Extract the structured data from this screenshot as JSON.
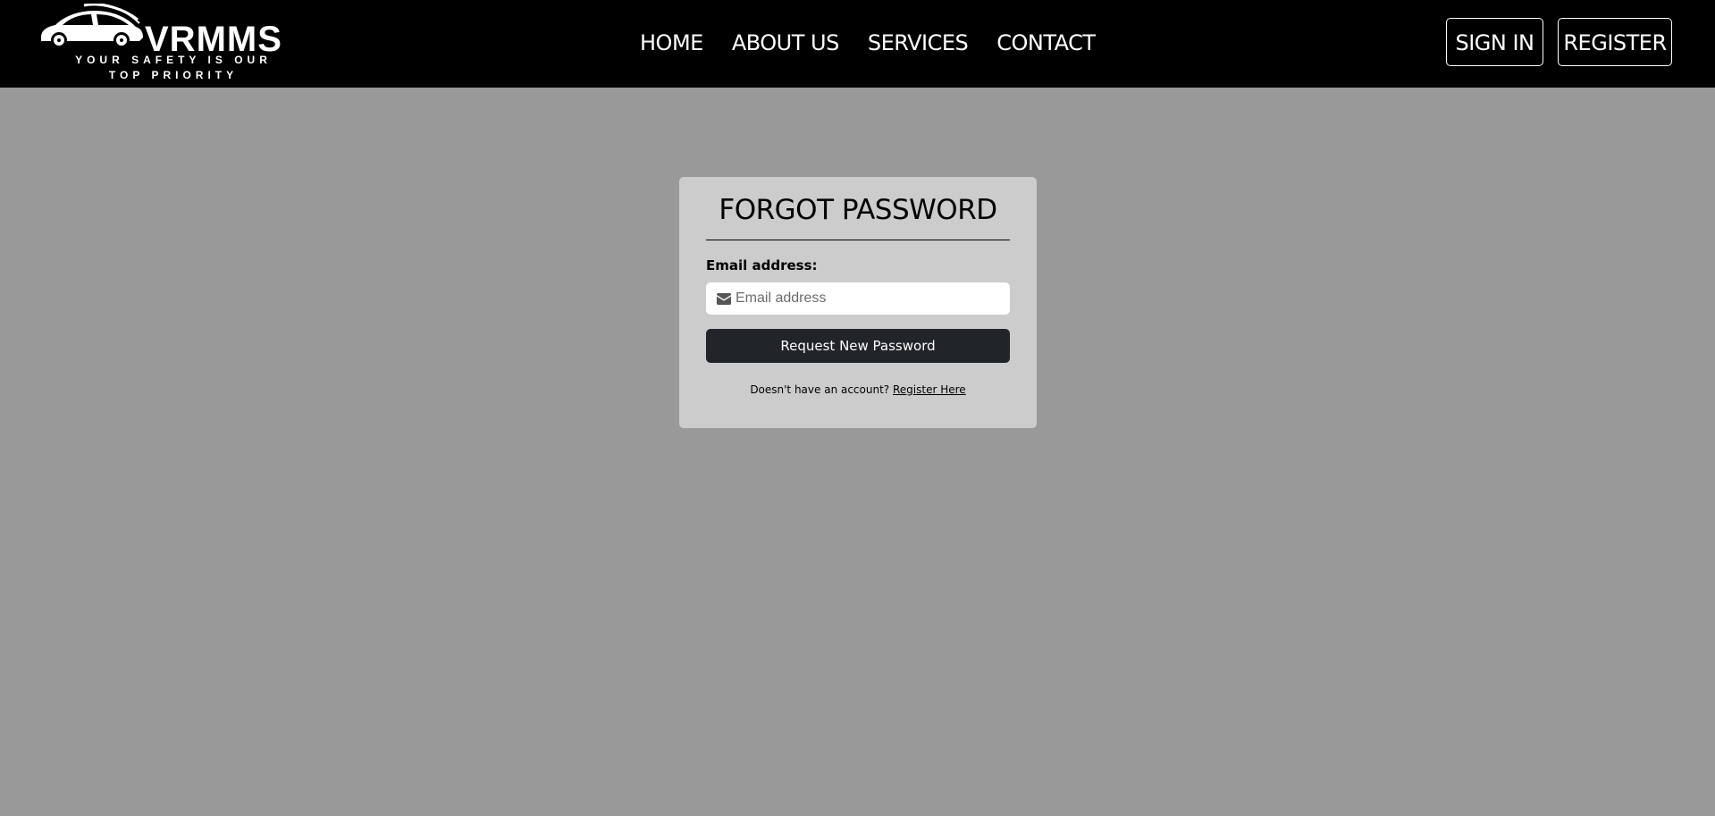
{
  "brand": {
    "name": "VRMMS",
    "tagline_line1": "YOUR SAFETY IS OUR",
    "tagline_line2": "TOP PRIORITY",
    "logo_icon": "car-icon"
  },
  "nav": {
    "links": [
      "HOME",
      "ABOUT US",
      "SERVICES",
      "CONTACT"
    ],
    "signin_label": "SIGN IN",
    "register_label": "REGISTER"
  },
  "form": {
    "title": "FORGOT PASSWORD",
    "email_label": "Email address:",
    "email_placeholder": "Email address",
    "email_value": "",
    "email_icon": "envelope-icon",
    "submit_label": "Request New Password",
    "account_prompt": "Doesn't have an account?",
    "register_link": "Register Here"
  },
  "colors": {
    "navbar": "#000000",
    "page_background": "#999999",
    "card_background": "#cccccc",
    "button": "#212529"
  }
}
